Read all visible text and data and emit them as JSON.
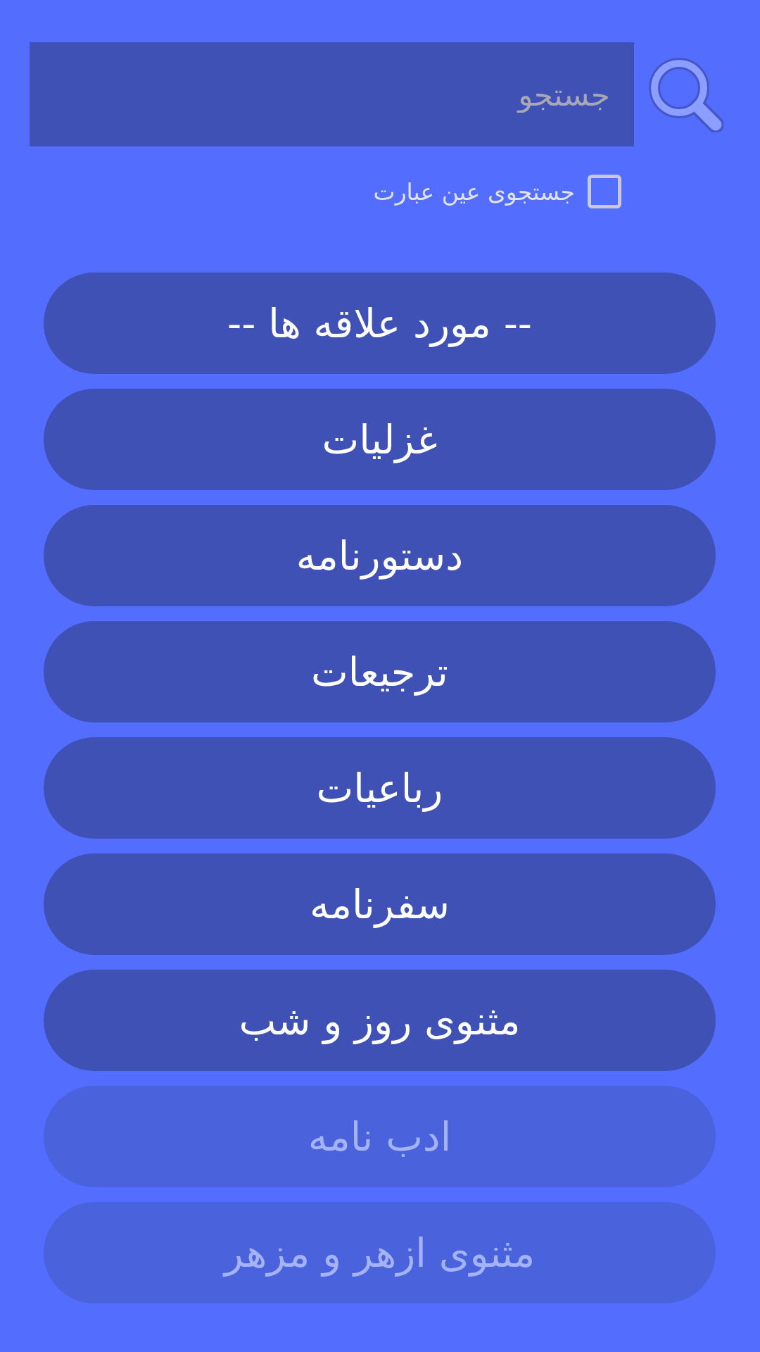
{
  "search": {
    "placeholder": "جستجو"
  },
  "exact_match": {
    "label": "جستجوی عین عبارت",
    "checked": false
  },
  "items": [
    {
      "label": "-- مورد علاقه ها --",
      "disabled": false
    },
    {
      "label": "غزلیات",
      "disabled": false
    },
    {
      "label": "دستورنامه",
      "disabled": false
    },
    {
      "label": "ترجیعات",
      "disabled": false
    },
    {
      "label": "رباعیات",
      "disabled": false
    },
    {
      "label": "سفرنامه",
      "disabled": false
    },
    {
      "label": "مثنوی روز و شب",
      "disabled": false
    },
    {
      "label": "ادب نامه",
      "disabled": true
    },
    {
      "label": "مثنوی ازهر و مزهر",
      "disabled": true
    }
  ]
}
